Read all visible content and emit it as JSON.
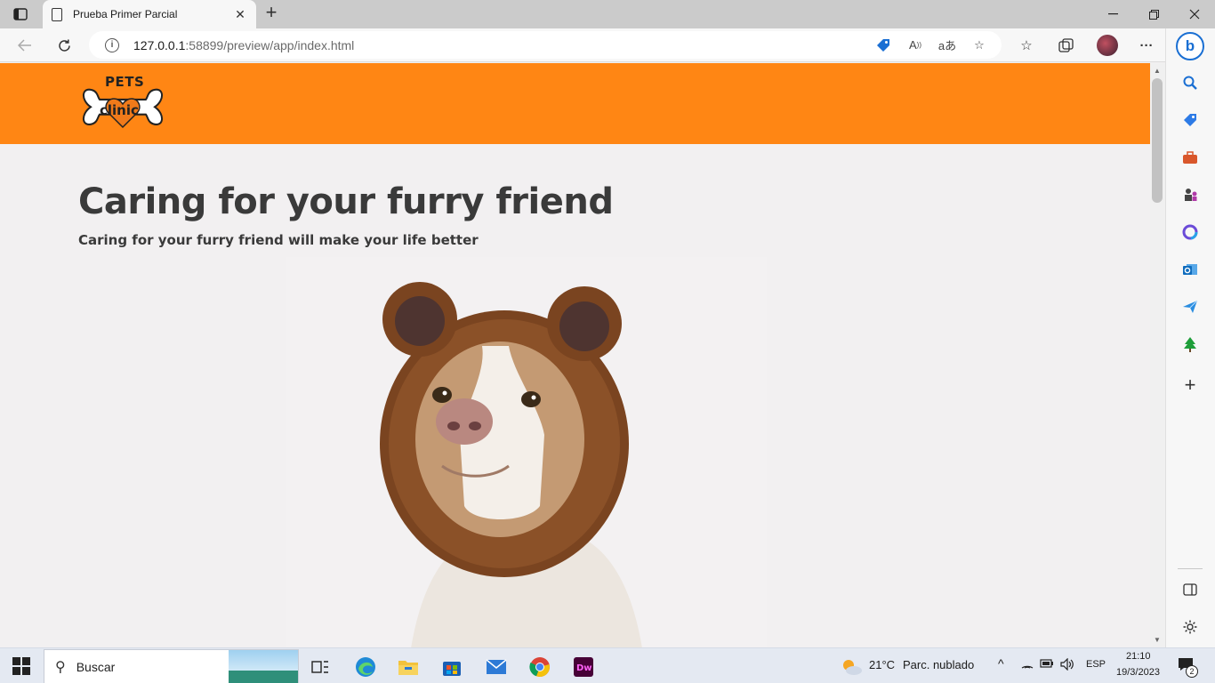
{
  "browser": {
    "tab_title": "Prueba Primer Parcial",
    "new_tab_symbol": "+",
    "url_host": "127.0.0.1",
    "url_rest": ":58899/preview/app/index.html"
  },
  "page": {
    "logo_line1": "PETS",
    "logo_line2": "clinic",
    "hero_title": "Caring for your furry friend",
    "hero_subtitle": "Caring for your furry friend will make your life better",
    "header_color": "#ff8614"
  },
  "taskbar": {
    "search_placeholder": "Buscar",
    "weather_temp": "21°C",
    "weather_desc": "Parc. nublado",
    "language": "ESP",
    "time": "21:10",
    "date": "19/3/2023",
    "notification_count": "2"
  },
  "icons": {
    "edge_sidebar": [
      "search-icon",
      "tag-icon",
      "toolbox-icon",
      "chess-icon",
      "office-icon",
      "outlook-icon",
      "send-icon",
      "tree-icon",
      "add-icon",
      "panel-icon",
      "settings-icon"
    ]
  }
}
